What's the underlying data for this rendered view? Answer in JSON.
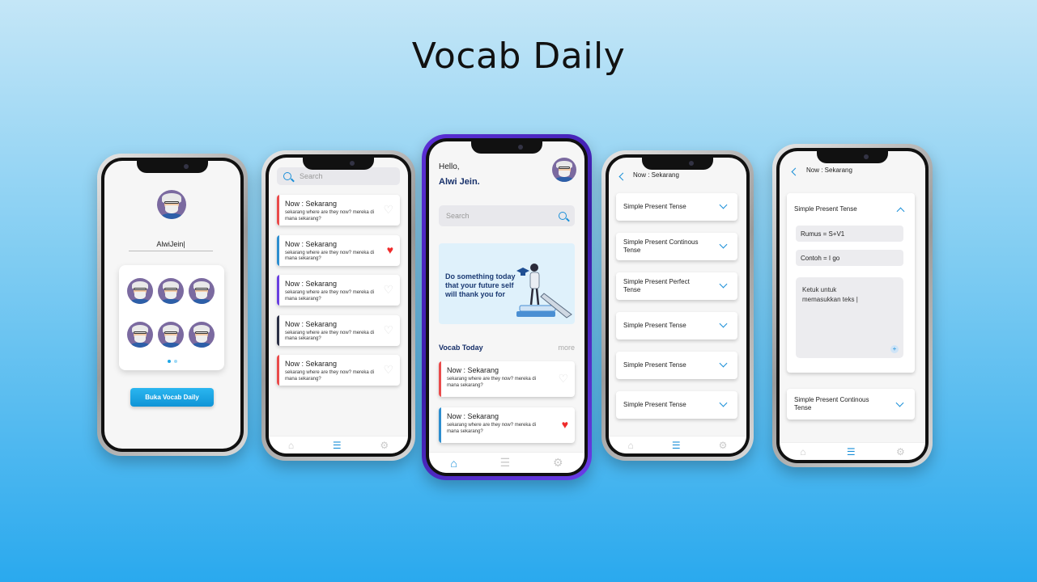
{
  "headline": "Vocab Daily",
  "screen1": {
    "name_input": "AlwiJein|",
    "cta": "Buka Vocab Daily"
  },
  "list_screen": {
    "search_placeholder": "Search",
    "items": [
      {
        "title": "Now : Sekarang",
        "desc": "sekarang where are they now? mereka di mana sekarang?",
        "fav": false,
        "color": "#ea4b4b"
      },
      {
        "title": "Now : Sekarang",
        "desc": "sekarang where are they now? mereka di mana sekarang?",
        "fav": true,
        "color": "#2d8ecf"
      },
      {
        "title": "Now : Sekarang",
        "desc": "sekarang where are they now? mereka di mana sekarang?",
        "fav": false,
        "color": "#6a3fe0"
      },
      {
        "title": "Now : Sekarang",
        "desc": "sekarang where are they now? mereka di mana sekarang?",
        "fav": false,
        "color": "#2b2f45"
      },
      {
        "title": "Now : Sekarang",
        "desc": "sekarang where are they now? mereka di mana sekarang?",
        "fav": false,
        "color": "#ea4b4b"
      }
    ]
  },
  "home_screen": {
    "greeting": "Hello,",
    "user_name": "Alwi Jein.",
    "search_placeholder": "Search",
    "quote": "Do something today that your future self will thank you for",
    "section_title": "Vocab Today",
    "more_link": "more",
    "items": [
      {
        "title": "Now : Sekarang",
        "desc": "sekarang where are they now? mereka di mana sekarang?",
        "fav": false,
        "color": "#ea4b4b"
      },
      {
        "title": "Now : Sekarang",
        "desc": "sekarang where are they now? mereka di mana sekarang?",
        "fav": true,
        "color": "#2d8ecf"
      }
    ]
  },
  "tense_screen": {
    "title": "Now : Sekarang",
    "items": [
      "Simple Present Tense",
      "Simple Present Continous Tense",
      "Simple Present Perfect Tense",
      "Simple Present Tense",
      "Simple Present Tense",
      "Simple Present Tense"
    ]
  },
  "detail_screen": {
    "title": "Now : Sekarang",
    "expanded_title": "Simple Present Tense",
    "formula": "Rumus = S+V1",
    "example": "Contoh = I go",
    "note_placeholder": "Ketuk untuk memasukkan teks |",
    "next_item": "Simple Present Continous Tense"
  },
  "nav_icons": [
    "home-icon",
    "list-icon",
    "settings-icon"
  ],
  "colors": {
    "accent": "#1a8fd8",
    "dark_blue": "#17306a",
    "favorite": "#ef2b2b"
  }
}
